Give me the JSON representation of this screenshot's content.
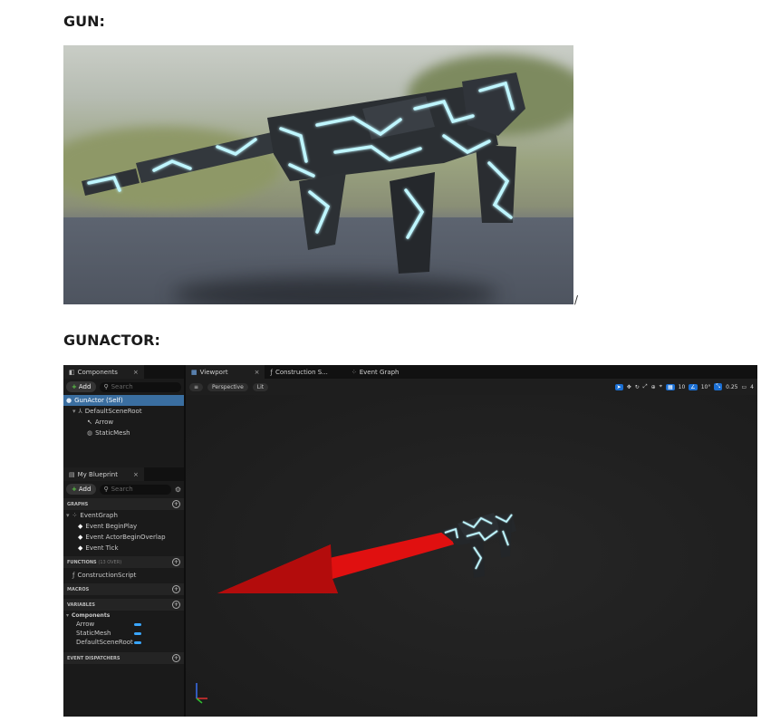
{
  "headings": {
    "gun": "GUN:",
    "gunactor": "GUNACTOR:"
  },
  "slash": "/",
  "colors": {
    "selection": "#3a6ea0",
    "accent_blue": "#1a6fd4",
    "add_green": "#5ecf48",
    "arrow_red": "#e01010",
    "glow": "#bff6ff"
  },
  "components_panel": {
    "tab_label": "Components",
    "add_label": "Add",
    "search_placeholder": "Search",
    "tree": [
      "GunActor (Self)",
      "DefaultSceneRoot",
      "Arrow",
      "StaticMesh"
    ]
  },
  "blueprint_panel": {
    "tab_label": "My Blueprint",
    "add_label": "Add",
    "search_placeholder": "Search",
    "graphs_label": "GRAPHS",
    "event_graph": "EventGraph",
    "events": [
      "Event BeginPlay",
      "Event ActorBeginOverlap",
      "Event Tick"
    ],
    "functions_label": "FUNCTIONS",
    "functions_sub": "(13 OVER)",
    "functions": [
      "ConstructionScript"
    ],
    "macros_label": "MACROS",
    "variables_label": "VARIABLES",
    "components_group": "Components",
    "variables": [
      "Arrow",
      "StaticMesh",
      "DefaultSceneRoot"
    ],
    "dispatchers_label": "EVENT DISPATCHERS"
  },
  "viewport": {
    "tabs": [
      "Viewport",
      "Construction S...",
      "Event Graph"
    ],
    "perspective": "Perspective",
    "lit": "Lit",
    "grid": "10",
    "angle": "10°",
    "scale": "0.25",
    "camera": "4"
  }
}
